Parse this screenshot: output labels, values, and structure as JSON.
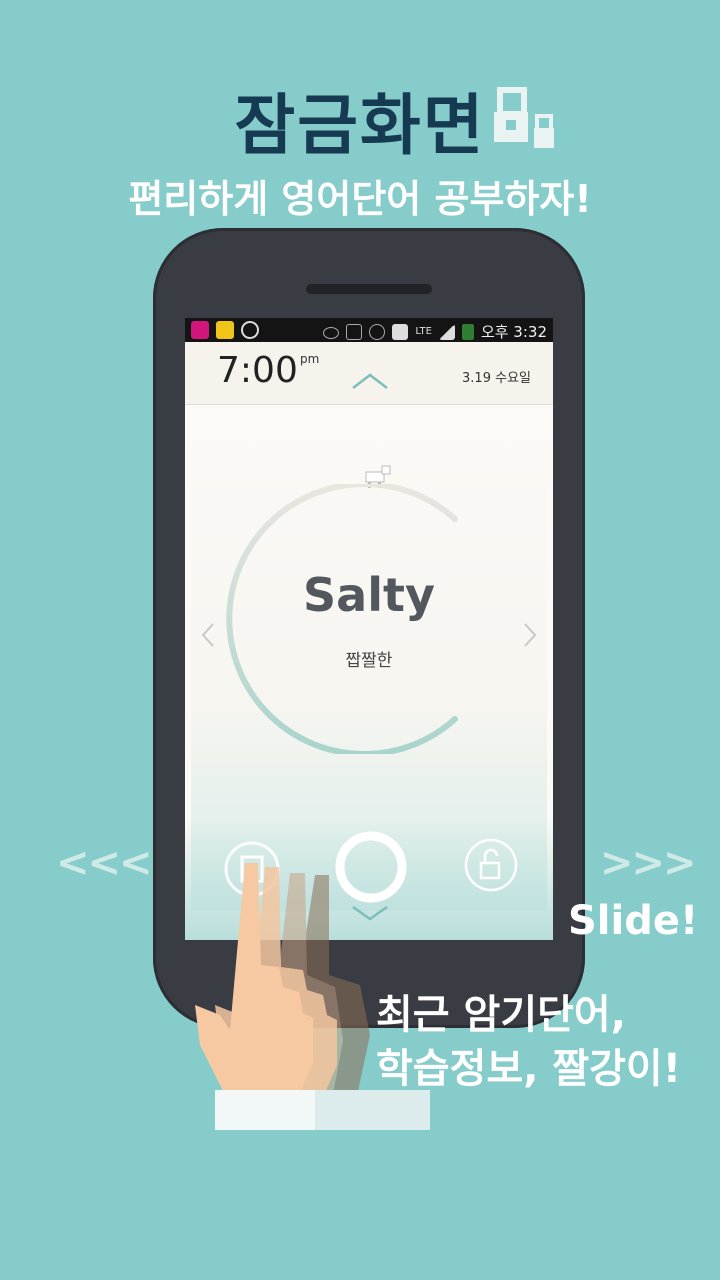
{
  "headline": "잠금화면",
  "subhead": "편리하게 영어단어 공부하자!",
  "status_bar": {
    "time": "오후 3:32",
    "network": "LTE",
    "icons_left": [
      "carrier-icon",
      "chat-icon",
      "minus-circle-icon"
    ],
    "icons_right": [
      "eye-icon",
      "mute-icon",
      "alarm-icon",
      "image-icon",
      "lte-icon",
      "signal-icon",
      "battery-icon"
    ]
  },
  "lock_header": {
    "clock": "7:00",
    "ampm": "pm",
    "date": "3.19 수요일"
  },
  "word_card": {
    "word": "Salty",
    "meaning": "짭짤한"
  },
  "side_arrows": {
    "left": "<<<",
    "right": ">>>"
  },
  "slide_label": "Slide!",
  "caption": {
    "line1": "최근 암기단어,",
    "line2": "학습정보, 짤강이!"
  },
  "colors": {
    "background": "#86cccb",
    "headline": "#163a52",
    "phone_body": "#3a3c44",
    "screen": "#fbfaf6",
    "accent_ring": "#a8d4cc"
  }
}
